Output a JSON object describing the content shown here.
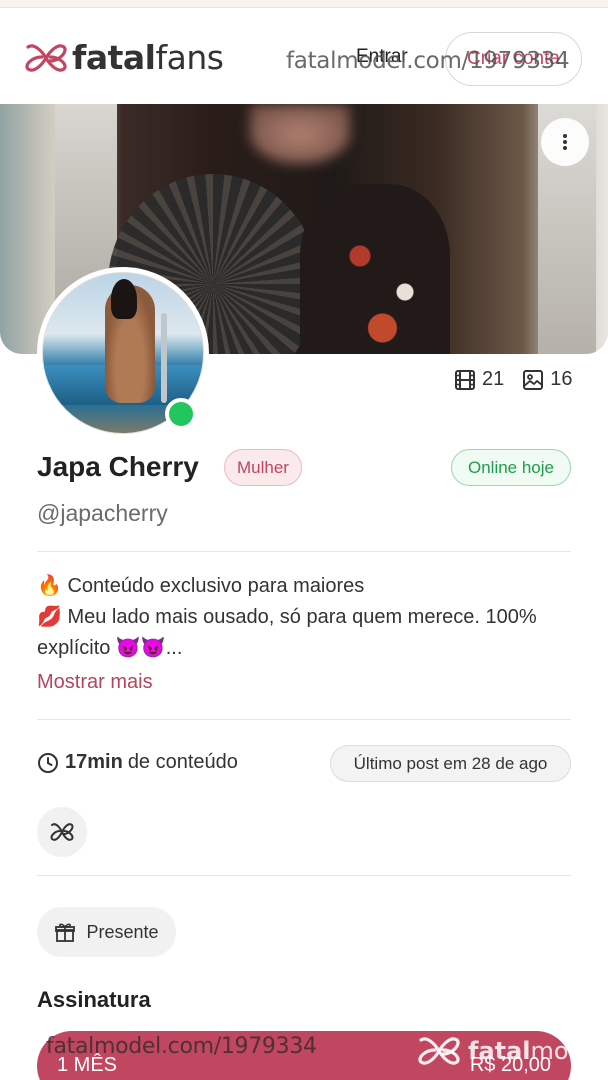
{
  "header": {
    "brand_bold": "fatal",
    "brand_light": "fans",
    "login_label": "Entrar",
    "signup_label": "Criar conta",
    "watermark": "fatalmodel.com/1979334"
  },
  "cover": {
    "menu_icon": "more-vertical-icon"
  },
  "profile": {
    "videos_count": "21",
    "photos_count": "16",
    "name": "Japa Cherry",
    "gender_badge": "Mulher",
    "status_badge": "Online hoje",
    "handle": "@japacherry"
  },
  "bio": {
    "line1": "🔥 Conteúdo exclusivo para maiores",
    "line2": "💋 Meu lado mais ousado, só para quem merece. 100%",
    "line3": "explícito 😈😈...",
    "show_more": "Mostrar mais"
  },
  "content_info": {
    "duration_value": "17min",
    "duration_label": "de conteúdo",
    "last_post": "Último post em 28 de ago"
  },
  "actions": {
    "gift_label": "Presente"
  },
  "subscription": {
    "title": "Assinatura",
    "plan_label": "1 MÊS",
    "plan_price": "R$ 20,00",
    "watermark": "fatalmodel.com/1979334",
    "watermark_logo_bold": "fatal",
    "watermark_logo_light": "model"
  },
  "colors": {
    "accent": "#c0475f",
    "online": "#22c55e"
  }
}
